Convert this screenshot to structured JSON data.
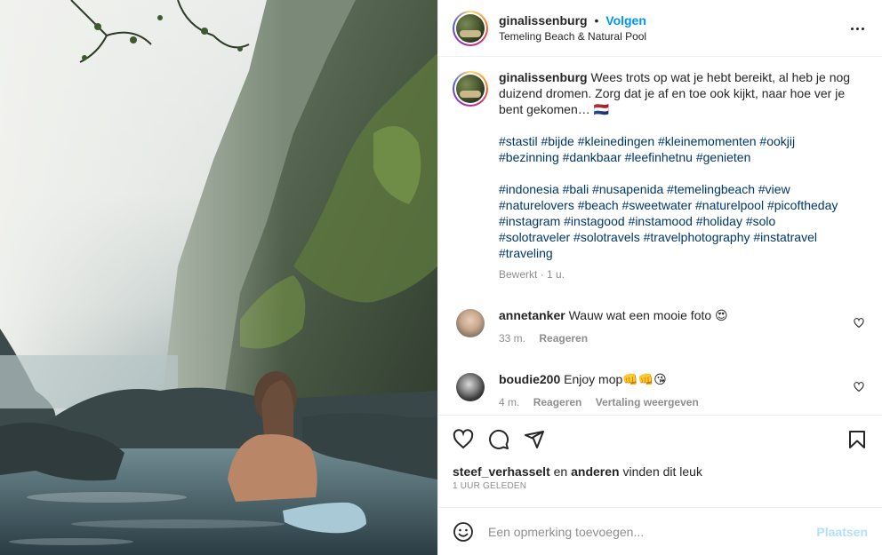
{
  "header": {
    "username": "ginalissenburg",
    "separator": "•",
    "follow_label": "Volgen",
    "location": "Temeling Beach & Natural Pool"
  },
  "caption": {
    "username": "ginalissenburg",
    "text": "Wees trots op wat je hebt bereikt, al heb je nog duizend dromen. Zorg dat je af en toe ook kijkt, naar hoe ver je bent gekomen… 🇳🇱",
    "tags_1": [
      "#stastil #bijde #kleinedingen #kleinemomenten #ookjij",
      "#bezinning #dankbaar #leefinhetnu #genieten"
    ],
    "tags_2": [
      "#indonesia #bali #nusapenida #temelingbeach #view",
      "#naturelovers #beach #sweetwater #naturelpool #picoftheday",
      "#instagram #instagood #instamood #holiday #solo",
      "#solotraveler #solotravels #travelphotography #instatravel",
      "#traveling"
    ],
    "edited": "Bewerkt",
    "age": "1 u."
  },
  "comments": [
    {
      "username": "annetanker",
      "text": "Wauw wat een mooie foto 😍",
      "age": "33 m.",
      "reply_label": "Reageren",
      "translate_label": ""
    },
    {
      "username": "boudie200",
      "text": "Enjoy mop👊👊😘",
      "age": "4 m.",
      "reply_label": "Reageren",
      "translate_label": "Vertaling weergeven"
    }
  ],
  "likes": {
    "user": "steef_verhasselt",
    "and": "en",
    "others": "anderen",
    "suffix": "vinden dit leuk",
    "time": "1 UUR GELEDEN"
  },
  "add_comment": {
    "placeholder": "Een opmerking toevoegen...",
    "post_label": "Plaatsen"
  },
  "icons": {
    "like": "heart-icon",
    "comment": "comment-icon",
    "share": "share-icon",
    "save": "bookmark-icon",
    "emoji": "emoji-icon",
    "more": "more-icon"
  },
  "colors": {
    "link": "#0095f6",
    "hashtag": "#00376b",
    "muted": "#8e8e8e",
    "post_disabled": "#b2dffc"
  }
}
